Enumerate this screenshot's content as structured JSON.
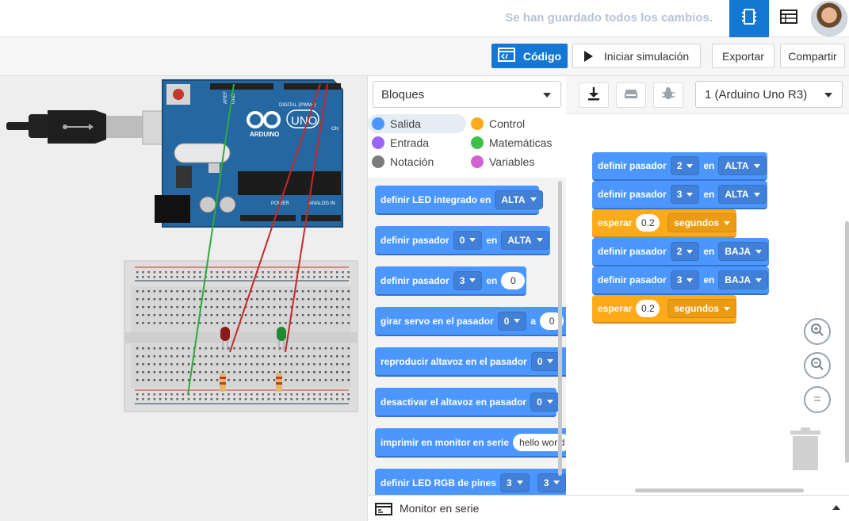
{
  "header": {
    "saved_status": "Se han guardado todos los cambios.",
    "accent": "#1477d1"
  },
  "toolbar": {
    "code_label": "Código",
    "simulate_label": "Iniciar simulación",
    "export_label": "Exportar",
    "share_label": "Compartir"
  },
  "board": {
    "brand": "ARDUINO",
    "model": "UNO",
    "digital_label": "DIGITAL (PWM~)",
    "analog_label": "ANALOG IN",
    "power_label": "POWER",
    "aref": "AREF",
    "gnd": "GND",
    "on_label": "ON"
  },
  "palette": {
    "dropdown": "Bloques",
    "categories": [
      {
        "label": "Salida",
        "color": "#4c97ff"
      },
      {
        "label": "Control",
        "color": "#ffab19"
      },
      {
        "label": "Entrada",
        "color": "#9966ff"
      },
      {
        "label": "Matemáticas",
        "color": "#40bf4a"
      },
      {
        "label": "Notación",
        "color": "#7d7d7d"
      },
      {
        "label": "Variables",
        "color": "#cf63cf"
      }
    ],
    "blocks": {
      "b1": {
        "text": "definir LED integrado en",
        "v1": "ALTA"
      },
      "b2": {
        "text": "definir pasador",
        "v1": "0",
        "mid": "en",
        "v2": "ALTA"
      },
      "b3": {
        "text": "definir pasador",
        "v1": "3",
        "mid": "en",
        "v2": "0"
      },
      "b4": {
        "text": "girar servo en el pasador",
        "v1": "0",
        "mid": "a",
        "v2": "0"
      },
      "b5": {
        "text": "reproducir altavoz en el pasador",
        "v1": "0"
      },
      "b6": {
        "text": "desactivar el altavoz en pasador",
        "v1": "0"
      },
      "b7": {
        "text": "imprimir en monitor en serie",
        "v1": "hello world"
      },
      "b8": {
        "text": "definir LED RGB de pines",
        "v1": "3",
        "v2": "3"
      }
    }
  },
  "workspace": {
    "board_select": "1 (Arduino Uno R3)",
    "blocks": {
      "w1": {
        "text": "definir pasador",
        "pin": "2",
        "mid": "en",
        "state": "ALTA"
      },
      "w2": {
        "text": "definir pasador",
        "pin": "3",
        "mid": "en",
        "state": "ALTA"
      },
      "w3": {
        "text": "esperar",
        "value": "0.2",
        "unit": "segundos"
      },
      "w4": {
        "text": "definir pasador",
        "pin": "2",
        "mid": "en",
        "state": "BAJA"
      },
      "w5": {
        "text": "definir pasador",
        "pin": "3",
        "mid": "en",
        "state": "BAJA"
      },
      "w6": {
        "text": "esperar",
        "value": "0.2",
        "unit": "segundos"
      }
    },
    "zoom_reset": "="
  },
  "serial_monitor": {
    "label": "Monitor en serie"
  }
}
